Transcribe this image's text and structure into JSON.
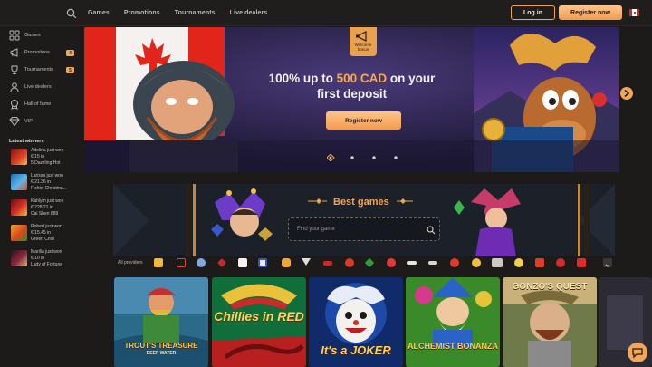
{
  "header": {
    "nav": [
      "Games",
      "Promotions",
      "Tournaments",
      "Live dealers"
    ],
    "login_label": "Log in",
    "register_label": "Register now",
    "flag": "canada-flag-icon"
  },
  "sidebar": {
    "items": [
      {
        "label": "Games",
        "icon": "games-icon"
      },
      {
        "label": "Promotions",
        "icon": "promotions-icon",
        "badge": "4"
      },
      {
        "label": "Tournaments",
        "icon": "trophy-icon",
        "badge": "5"
      },
      {
        "label": "Live dealers",
        "icon": "live-dealers-icon"
      },
      {
        "label": "Hall of fame",
        "icon": "hall-of-fame-icon"
      },
      {
        "label": "VIP",
        "icon": "vip-diamond-icon"
      }
    ],
    "winners_title": "Latest winners",
    "winners": [
      {
        "name": "Adelina just won",
        "amount": "€ 15 in",
        "game": "5 Dazzling Hot"
      },
      {
        "name": "Larissa just won",
        "amount": "€ 21.36 in",
        "game": "Fishin' Christma..."
      },
      {
        "name": "Kahlym just won",
        "amount": "€ 228.21 in",
        "game": "Cai Shen 889"
      },
      {
        "name": "Robert just won",
        "amount": "€ 15.45 in",
        "game": "Green Chilli"
      },
      {
        "name": "Marilia just won",
        "amount": "€ 10 in",
        "game": "Lady of Fortune"
      }
    ]
  },
  "banner": {
    "welcome_tag": "Welcome bonus",
    "title_part1": "100% up to ",
    "title_highlight": "500 CAD",
    "title_part2": " on your",
    "title_line2": "first deposit",
    "cta": "Register now",
    "slides": 4,
    "active_slide": 1
  },
  "best_games": {
    "title": "Best games",
    "search_placeholder": "Find your game",
    "providers_label": "All providers"
  },
  "games": [
    {
      "title": "TROUT'S TREASURE",
      "subtitle": "DEEP WATER"
    },
    {
      "title": "Chillies in RED"
    },
    {
      "title": "It's a JOKER"
    },
    {
      "title": "ALCHEMIST BONANZA"
    },
    {
      "title": "GONZO'S QUEST"
    }
  ],
  "colors": {
    "accent": "#f2a65a",
    "background": "#1d1b1a",
    "banner_bg": "#241f3d"
  }
}
